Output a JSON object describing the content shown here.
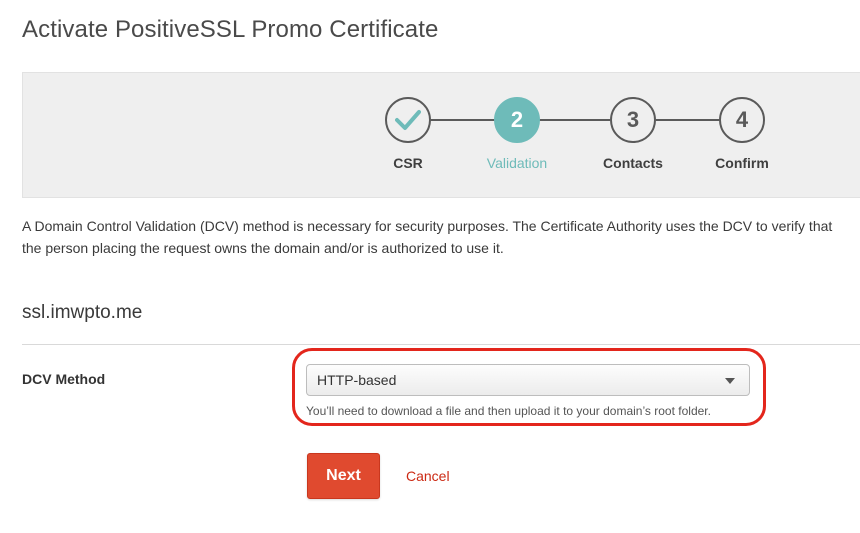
{
  "page": {
    "title": "Activate PositiveSSL Promo Certificate"
  },
  "stepper": {
    "steps": [
      {
        "label": "CSR",
        "number": "1",
        "state": "complete",
        "icon": "checkmark-icon"
      },
      {
        "label": "Validation",
        "number": "2",
        "state": "active"
      },
      {
        "label": "Contacts",
        "number": "3",
        "state": "pending"
      },
      {
        "label": "Confirm",
        "number": "4",
        "state": "pending"
      }
    ],
    "active_color": "#6ebbb9"
  },
  "description": "A Domain Control Validation (DCV) method is necessary for security purposes. The Certificate Authority uses the DCV to verify that the person placing the request owns the domain and/or is authorized to use it.",
  "domain": "ssl.imwpto.me",
  "dcv": {
    "label": "DCV Method",
    "selected": "HTTP-based",
    "help": "You’ll need to download a file and then upload it to your domain’s root folder.",
    "highlight_color": "#e3261c"
  },
  "actions": {
    "next_label": "Next",
    "cancel_label": "Cancel",
    "next_color": "#e04a2f"
  }
}
